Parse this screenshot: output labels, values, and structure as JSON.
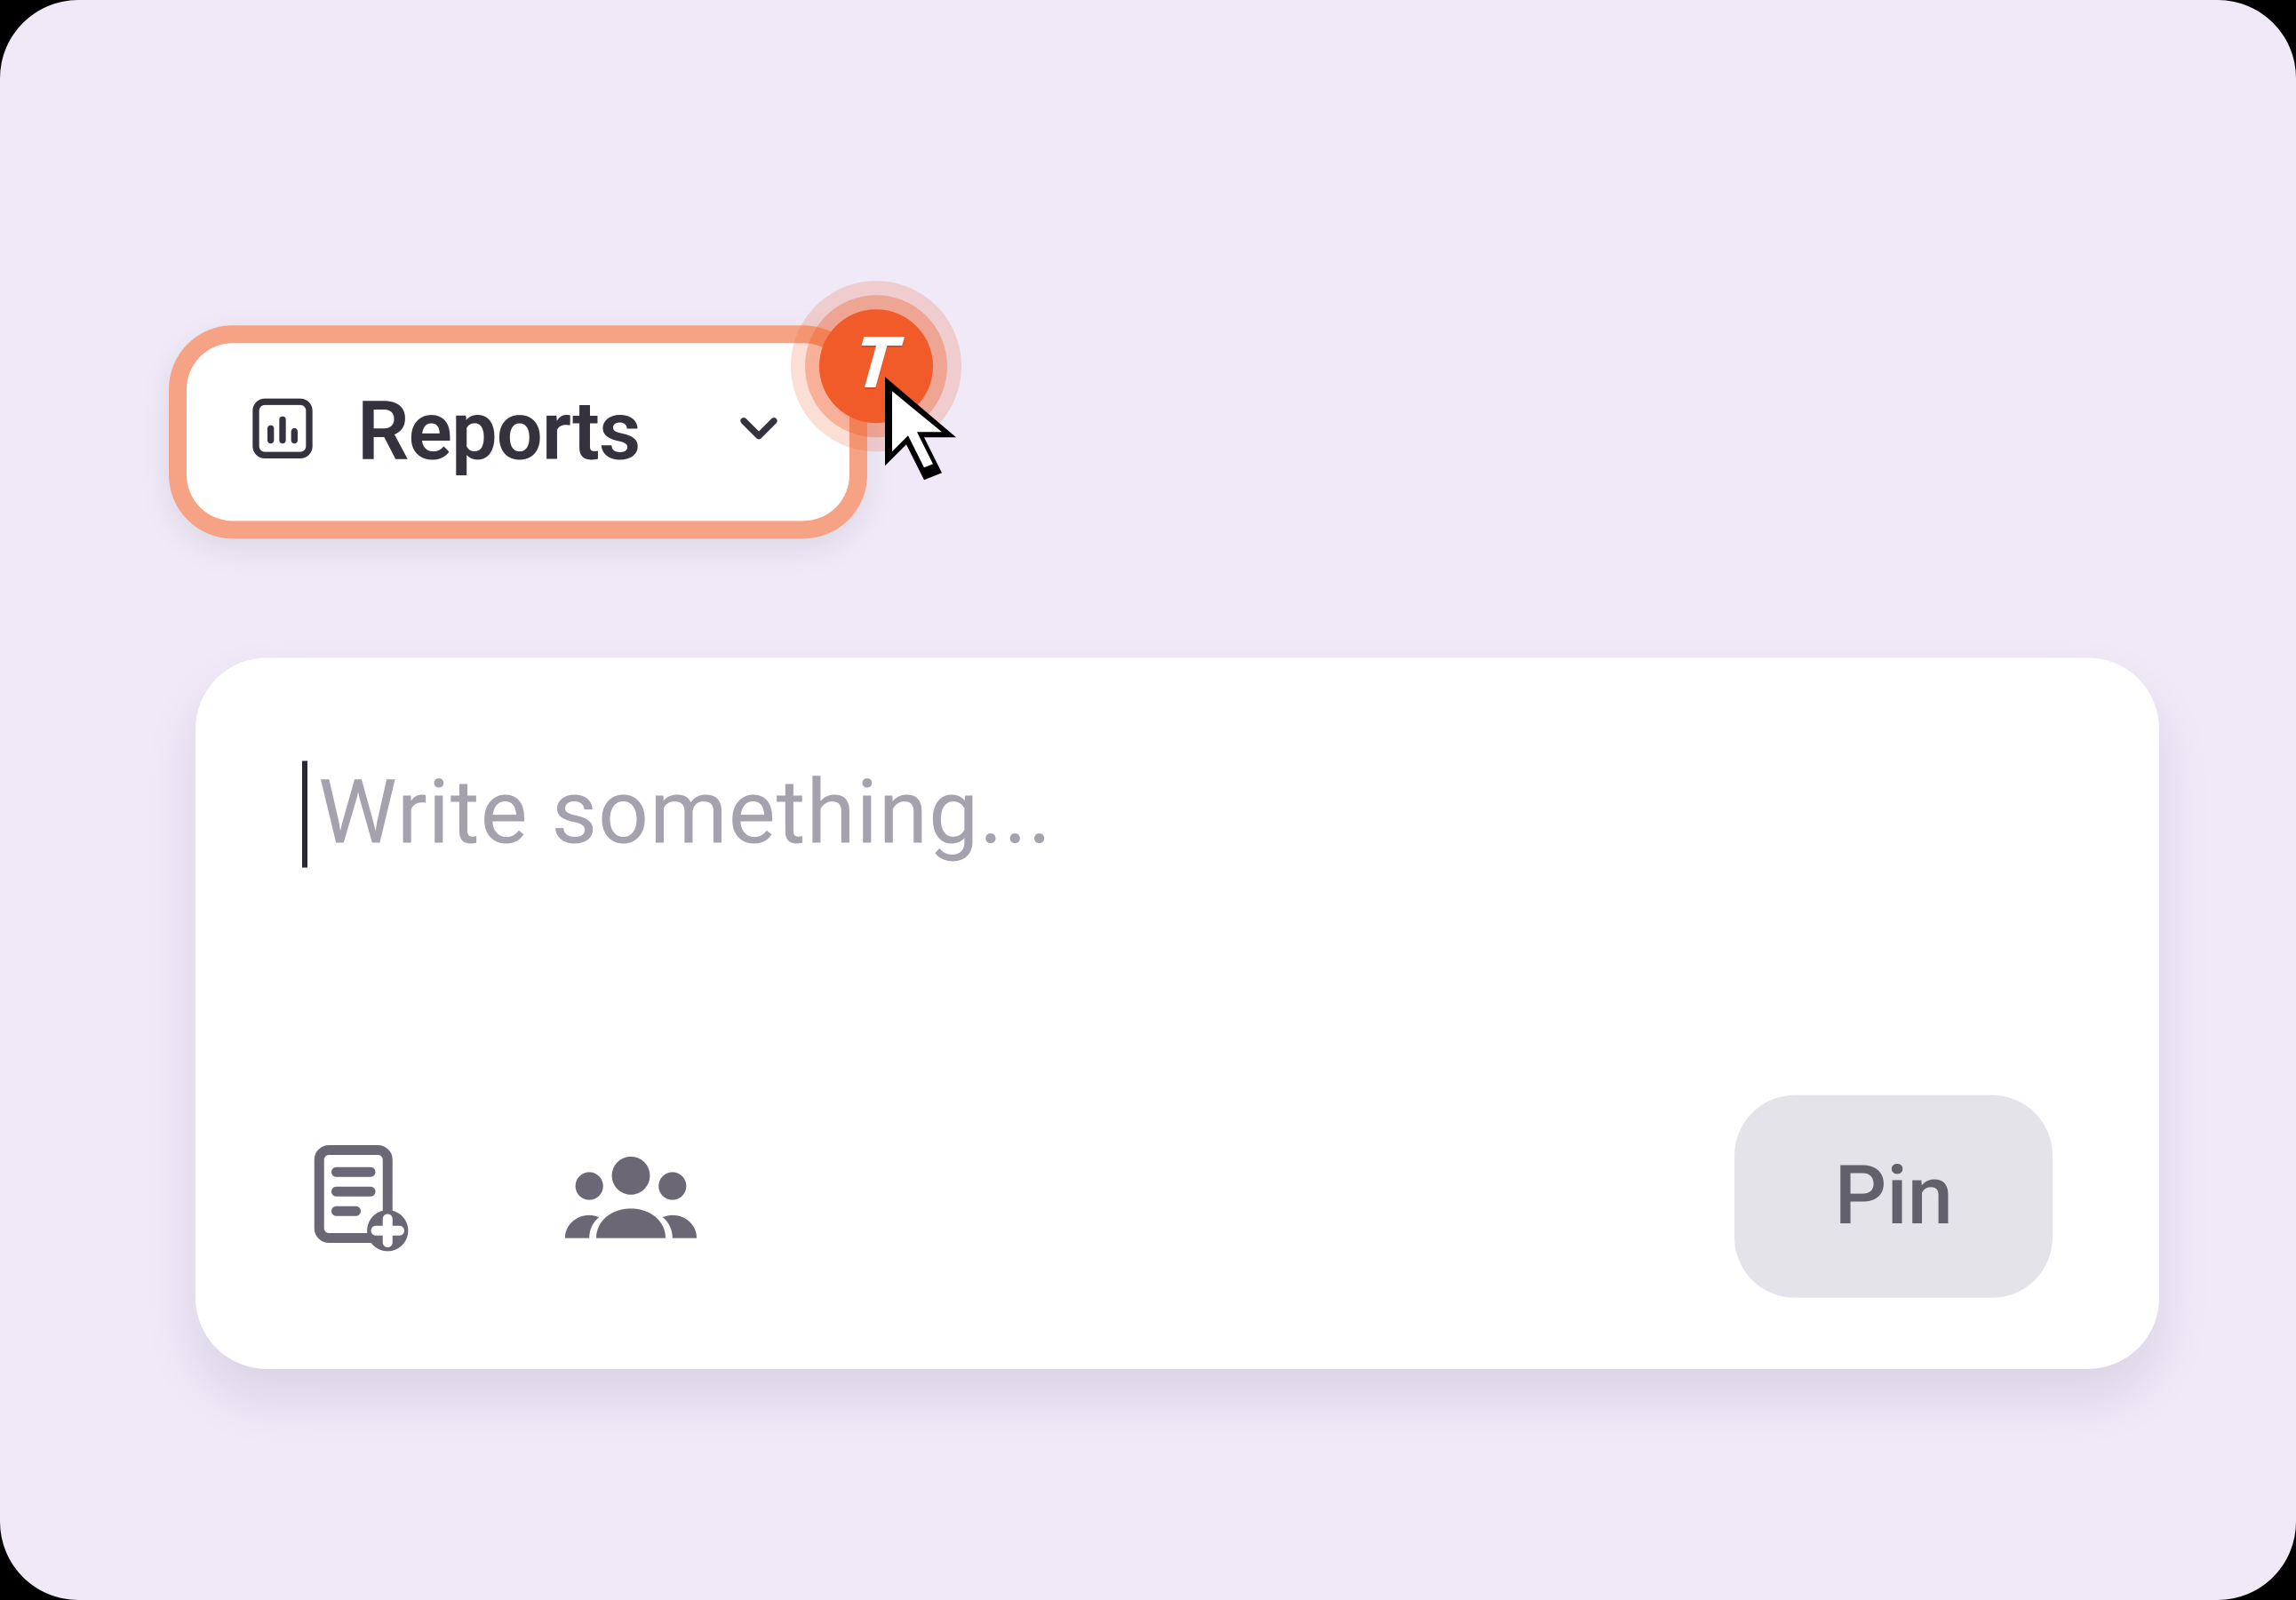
{
  "dropdown": {
    "label": "Reports"
  },
  "badge": {
    "glyph": "T"
  },
  "composer": {
    "placeholder": "Write something...",
    "pin_label": "Pin"
  }
}
